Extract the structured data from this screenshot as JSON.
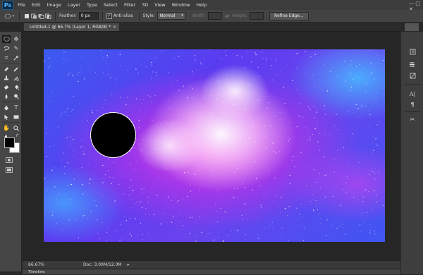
{
  "menu": {
    "logo": "Ps",
    "items": [
      "File",
      "Edit",
      "Image",
      "Layer",
      "Type",
      "Select",
      "Filter",
      "3D",
      "View",
      "Window",
      "Help"
    ]
  },
  "options": {
    "feather_label": "Feather:",
    "feather_value": "0 px",
    "antialias_label": "Anti-alias",
    "style_label": "Style:",
    "style_value": "Normal",
    "width_label": "Width:",
    "height_label": "Height:",
    "refine_edge_label": "Refine Edge..."
  },
  "document": {
    "tab_title": "Untitled-1 @ 66.7% (Layer 1, RGB/8) *",
    "tab_close": "×"
  },
  "status": {
    "zoom": "66.67%",
    "doc_size": "Doc: 3.00M/12.0M"
  },
  "timeline": {
    "label": "Timeline"
  },
  "colors": {
    "foreground": "#000000",
    "background": "#ffffff",
    "selection_fill": "#000000"
  },
  "icons": {
    "toolbar": [
      "elliptical-marquee-icon",
      "move-icon",
      "lasso-icon",
      "quick-selection-icon",
      "crop-icon",
      "eyedropper-icon",
      "healing-brush-icon",
      "brush-icon",
      "clone-stamp-icon",
      "history-brush-icon",
      "eraser-icon",
      "paint-bucket-icon",
      "blur-icon",
      "dodge-icon",
      "pen-icon",
      "type-icon",
      "path-selection-icon",
      "rectangle-shape-icon",
      "hand-icon",
      "zoom-icon"
    ],
    "right_panel": [
      "history-icon",
      "layers-icon",
      "adjustments-icon",
      "character-icon",
      "paragraph-icon",
      "tool-presets-icon"
    ]
  }
}
